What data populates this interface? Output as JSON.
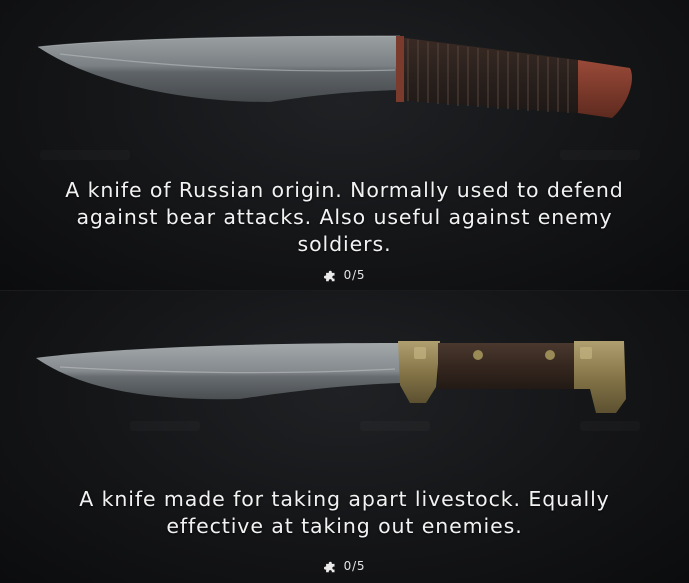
{
  "items": [
    {
      "name": "russian-knife",
      "description_lines": [
        "A knife of Russian origin. Normally used to defend",
        "against bear attacks. Also useful against enemy",
        "soldiers."
      ],
      "collectible_icon": "puzzle-piece-icon",
      "collectible_progress": "0/5"
    },
    {
      "name": "butcher-knife",
      "description_lines": [
        "A knife made for taking apart livestock. Equally",
        "effective at taking out enemies."
      ],
      "collectible_icon": "puzzle-piece-icon",
      "collectible_progress": "0/5"
    }
  ],
  "colors": {
    "background": "#141517",
    "text": "#f2f2f2",
    "blade": "#8a8f93",
    "leather_handle": "#6b3427",
    "wood_handle": "#3b2c24",
    "brass": "#8a7a48"
  }
}
